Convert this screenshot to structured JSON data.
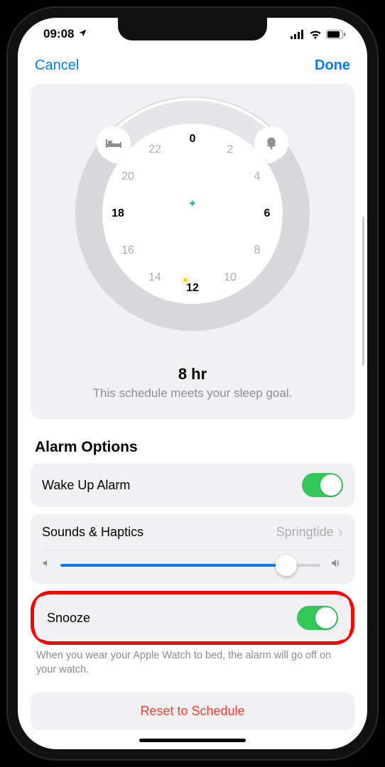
{
  "status": {
    "time": "09:08"
  },
  "nav": {
    "cancel": "Cancel",
    "done": "Done"
  },
  "clock": {
    "hours": [
      "0",
      "2",
      "4",
      "6",
      "8",
      "10",
      "12",
      "14",
      "16",
      "18",
      "20",
      "22"
    ],
    "bold_hours": [
      "0",
      "6",
      "12",
      "18"
    ],
    "duration": "8 hr",
    "goal": "This schedule meets your sleep goal."
  },
  "alarm": {
    "section_title": "Alarm Options",
    "wake": {
      "label": "Wake Up Alarm",
      "on": true
    },
    "sounds": {
      "label": "Sounds & Haptics",
      "value": "Springtide"
    },
    "volume_pct": 87,
    "snooze": {
      "label": "Snooze",
      "on": true
    },
    "note": "When you wear your Apple Watch to bed, the alarm will go off on your watch.",
    "reset": "Reset to Schedule"
  }
}
